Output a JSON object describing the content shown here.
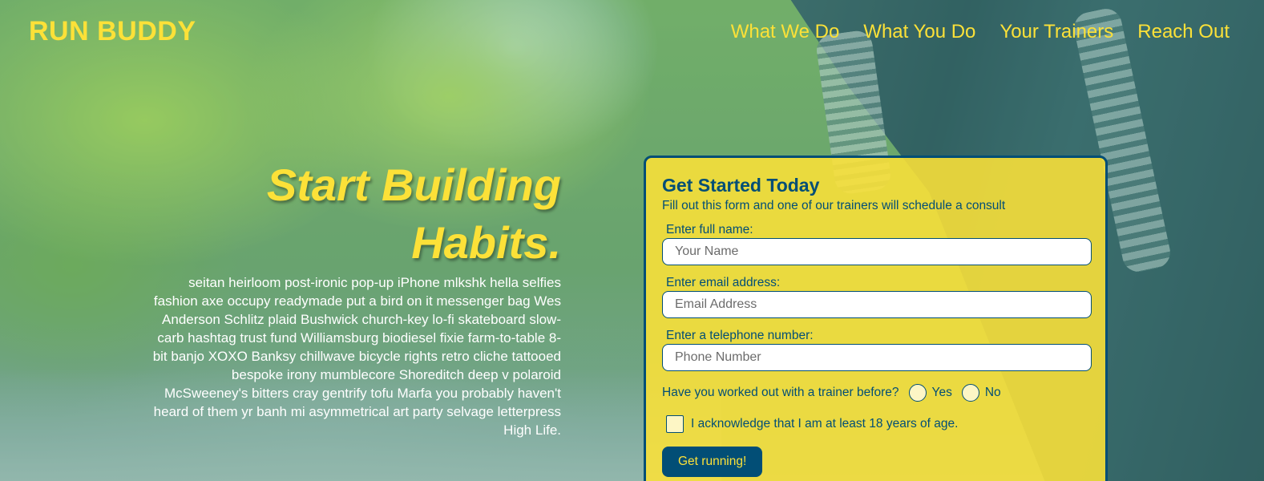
{
  "header": {
    "logo": "RUN BUDDY",
    "nav": [
      {
        "label": "What We Do"
      },
      {
        "label": "What You Do"
      },
      {
        "label": "Your Trainers"
      },
      {
        "label": "Reach Out"
      }
    ]
  },
  "hero": {
    "title_line1": "Start Building",
    "title_line2": "Habits.",
    "body": "seitan heirloom post-ironic pop-up iPhone mlkshk hella selfies fashion axe occupy readymade put a bird on it messenger bag Wes Anderson Schlitz plaid Bushwick church-key lo-fi skateboard slow-carb hashtag trust fund Williamsburg biodiesel fixie farm-to-table 8-bit banjo XOXO Banksy chillwave bicycle rights retro cliche tattooed bespoke irony mumblecore Shoreditch deep v polaroid McSweeney's bitters cray gentrify tofu Marfa you probably haven't heard of them yr banh mi asymmetrical art party selvage letterpress High Life."
  },
  "form": {
    "title": "Get Started Today",
    "subtitle": "Fill out this form and one of our trainers will schedule a consult",
    "name": {
      "label": "Enter full name:",
      "placeholder": "Your Name",
      "value": ""
    },
    "email": {
      "label": "Enter email address:",
      "placeholder": "Email Address",
      "value": ""
    },
    "phone": {
      "label": "Enter a telephone number:",
      "placeholder": "Phone Number",
      "value": ""
    },
    "trainer_question": "Have you worked out with a trainer before?",
    "trainer_yes": "Yes",
    "trainer_no": "No",
    "acknowledge": "I acknowledge that I am at least 18 years of age.",
    "submit_label": "Get running!"
  },
  "colors": {
    "accent_yellow": "#fce138",
    "brand_blue": "#024e76"
  }
}
